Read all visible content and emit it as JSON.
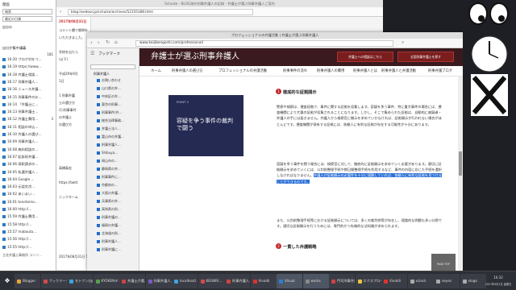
{
  "left_panel": {
    "header": "階段",
    "search_placeholder": "検索",
    "sort_label": "最近の日順",
    "folder_label": "自分の",
    "heading": "自分が集中講義",
    "items": [
      "16:20 ブログ村をつ...",
      "16:19 https://www...",
      "16:18 弁護士相談...",
      "16:17 刑事弁護人...",
      "16:16 ニュース弁護...",
      "16:15 刑事事件のお...",
      "16:14 「弁護士に...",
      "16:13 刑事弁護士...",
      "16:12 弁護士費用...",
      "16:11 相談の申込...",
      "16:10 弁護人の選び...",
      "16:09 刑事弁護人...",
      "16:08 無料相談の...",
      "16:07 起訴前弁護...",
      "16:06 保釈請求の...",
      "16:05 私選弁護人...",
      "16:04 Google ...",
      "16:03 示談交渉...",
      "16:02 あいまい...",
      "16:01 tonotomo...",
      "16:00 http://...",
      "15:59 弁護士費用...",
      "15:58 http://...",
      "15:57 mabouta...",
      "15:56 http://...",
      "15:55 http://..."
    ],
    "counts": [
      "181",
      "3"
    ],
    "footer": "立花弁護士事務所 コンソ..."
  },
  "back_window": {
    "title": "Schulze - BLOG海外刑事弁護人の記録 - 弁護士が選ぶ刑事弁護人ご案内",
    "url": "blog.livedoor.jp/schulze/archives/52155188.html"
  },
  "blog_column": {
    "date": "2017年08月31日",
    "lines": [
      "コメント欄で質問を",
      "いただきました。",
      "",
      "学校を出たら",
      "(以下)",
      "",
      "平成29年9月",
      "1日",
      "",
      "1 刑事弁護",
      "士の選び方",
      "(1)刑事事件",
      "の弁護士",
      "の選び方",
      "",
      "",
      "",
      "",
      "",
      "高橋泰宏",
      "",
      "https://twitt",
      "",
      "ニックネーム"
    ],
    "date2": "2017年08月31日 12:40"
  },
  "main_window": {
    "title": "プロフェッショナルの弁護活動 | 弁護士が選ぶ刑事弁護人",
    "url": "www.keijibengoshi.com/professional/",
    "sidebar": {
      "header": "ブックマーク",
      "section": "刑事弁護人",
      "items": [
        "お問い合わせ",
        "山口県の弁...",
        "中央区の弁...",
        "東京の刑事...",
        "刑事事件(弁...",
        "総合法律事務...",
        "弁護士法人...",
        "富山市の弁護...",
        "刑事弁護人...",
        "Shibuya...",
        "岡山市の...",
        "静岡県の弁...",
        "刑事事件に...",
        "京都府の...",
        "大阪の弁護...",
        "兵庫県の弁...",
        "高知県の刑...",
        "刑事弁護の...",
        "福岡の弁護...",
        "北海道の刑...",
        "刑事弁護人...",
        "刑事弁護に..."
      ]
    },
    "site": {
      "brand": "弁護士が選ぶ刑事弁護人",
      "header_buttons": [
        "弁護士への相談はこちら",
        "全国刑事弁護士を探す"
      ],
      "nav": [
        "ホーム",
        "刑事弁護人の選び方",
        "プロフェッショナルの弁護活動",
        "刑事事件の流れ",
        "刑事弁護人の費用",
        "刑事弁護人とは",
        "刑事弁護人と弁護活動",
        "刑事弁護ブログ"
      ],
      "book": {
        "tag": "POINT 2",
        "title": "容疑を争う事件の裁判で闘う"
      },
      "sections": [
        {
          "num": "1",
          "heading": "徹底的な証拠開示",
          "paras": [
            "警察や検察は、捜査段階で、事件に関する証拠を収集します。容疑を争う事件、特に重大事件の場合には、捜査機関により大量の証拠が収集されることになります。しかし、そこで集められた証拠は、自動的に被疑者・弁護人の手には届きません。弁護人から検察官に開示を求めていかなければ、証拠開示が行われない場合がほとんどです。捜査機関が保有する証拠には、依頼人に有利な証拠が存在する可能性が十分にあります。",
            "容疑を争う事件を闘う場合には、検察官に対して、徹底的に証拠開示を求めていく必要があります。適切に証拠開示を求めていくには、公判前整理手続や期日間整理手続を利用するなど、事件の内容に応じた手続を選択しなければなりません。弁護人が証拠開示の必要性を十分に理解していれば、依頼人に有利な証拠を見つけることができるのです。",
            "また、公判前整理手続等における証拠開示については、多くの裁判例等が存在し、理論的な問題も多い分野です。適切な証拠開示を行うためには、専門的かつ先端的な法知識が求められます。"
          ]
        },
        {
          "num": "2",
          "heading": "一貫した弁護戦略",
          "paras": []
        }
      ],
      "pagetop": "PAGE TOP"
    }
  },
  "taskbar": {
    "items": [
      "Blogger",
      "ブックマーク",
      "モトクン(@m...",
      "KYOKENデ...",
      "弁護士が選...",
      "刑事弁護人...",
      "localhost/...",
      "KEGNR/...",
      "刑事弁護人...",
      "Vivaldi",
      "Visual",
      "works",
      "門司刑事弁護",
      "エクスプロー",
      "Vivaldi",
      "xclock",
      "xeyes",
      "xlogo"
    ],
    "clock_time": "16:32",
    "clock_date": "2017年9月1日 金曜日"
  },
  "colors": {
    "accent": "#c0282b",
    "site_header": "#3a1a1e",
    "book": "#252a53",
    "highlight": "#2b6fd6"
  }
}
